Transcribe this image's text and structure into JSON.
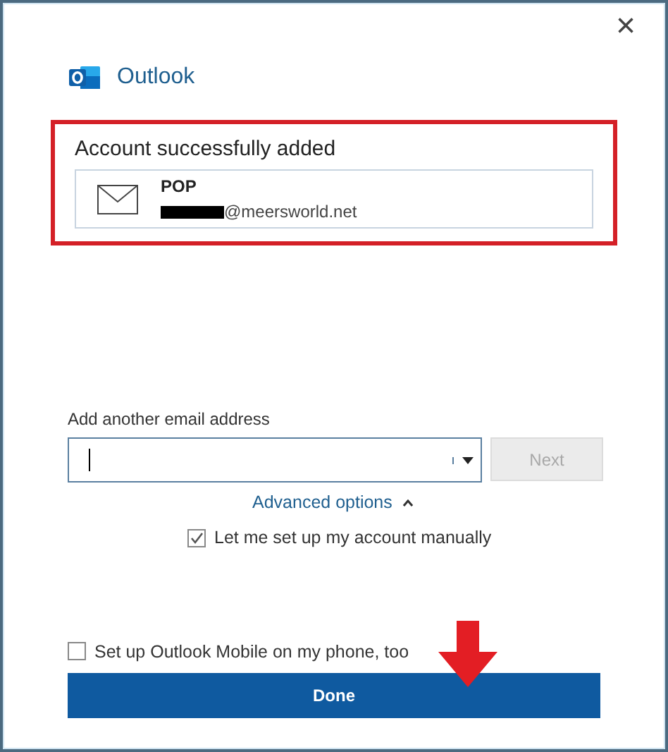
{
  "window": {
    "close": "×"
  },
  "app": {
    "name": "Outlook"
  },
  "result": {
    "title": "Account successfully added",
    "account": {
      "type": "POP",
      "email": "@meersworld.net",
      "redacted": true
    }
  },
  "add_email": {
    "label": "Add another email address",
    "next": {
      "label": "Next",
      "disabled": true
    }
  },
  "advanced": {
    "label": "Advanced options",
    "expanded": true,
    "options": [
      {
        "label": "Let me set up my account manually",
        "checked": true
      }
    ]
  },
  "mobile": {
    "label": "Set up Outlook Mobile on my phone, too",
    "checked": false
  },
  "done": {
    "label": "Done"
  },
  "annotations": {
    "highlight_box": true,
    "arrow": true
  }
}
